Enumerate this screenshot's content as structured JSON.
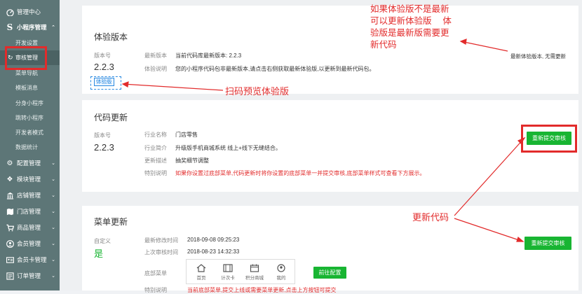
{
  "sidebar": {
    "top": "管理中心",
    "group_mini": "小程序管理",
    "sub_items": [
      "开发设置",
      "审核管理",
      "菜单导航",
      "模板消息",
      "分身小程序",
      "跳转小程序",
      "开发者模式",
      "数据统计"
    ],
    "groups": [
      "配置管理",
      "模块管理",
      "店铺管理",
      "门店管理",
      "商品管理",
      "会员管理",
      "会员卡管理",
      "订单管理"
    ]
  },
  "exp": {
    "title": "体验版本",
    "ver_label": "版本号",
    "version": "2.2.3",
    "tag": "体验版 ",
    "latest_label": "最新版本",
    "latest_value": "当前代码库最新版本: 2.2.3",
    "desc_label": "体验说明",
    "desc_value": "您的小程序代码包非最新版本,请点击右侧获取最新体验版,以更新到最新代码包。",
    "right_status": "最新体验版本, 无需更新"
  },
  "code": {
    "title": "代码更新",
    "ver_label": "版本号",
    "version": "2.2.3",
    "rows": [
      {
        "label": "行业名称",
        "value": "门店零售"
      },
      {
        "label": "行业简介",
        "value": "升级版手机商城系统 线上+线下无缝结合。"
      },
      {
        "label": "更新描述",
        "value": "抽奖细节调整"
      },
      {
        "label": "特别说明",
        "value": "如果你设置过底部菜单,代码更新时将你设置的底部菜单一并提交审核,底部菜单样式可查看下方展示。"
      }
    ],
    "button": "重新提交审核"
  },
  "menu": {
    "title": "菜单更新",
    "custom_label": "自定义",
    "custom_value": "是",
    "rows": [
      {
        "label": "最新修改时间",
        "value": "2018-09-08 09:25:23"
      },
      {
        "label": "上次审核时间",
        "value": "2018-08-23 14:32:33"
      }
    ],
    "bottom_label": "底部菜单",
    "tabs": [
      "首页",
      "计次卡",
      "积分商城",
      "我的"
    ],
    "goto_button": "前往配置",
    "special_label": "特别说明",
    "special_value": "当前底部菜单,提交上线或需要菜单更新,点击上方按钮可提交",
    "button": "重新提交审核"
  },
  "annotations": {
    "top_note": [
      "如果体验版不是最新",
      "可以更新体验版    体",
      "验版是最新版需要更",
      "新代码"
    ],
    "scan_note": "扫码预览体验版",
    "update_note": "更新代码"
  },
  "colors": {
    "sidebar": "#5d7677",
    "accent_green": "#18b532",
    "annotation_red": "#e22b2b",
    "tag_blue": "#2b8ae0"
  }
}
